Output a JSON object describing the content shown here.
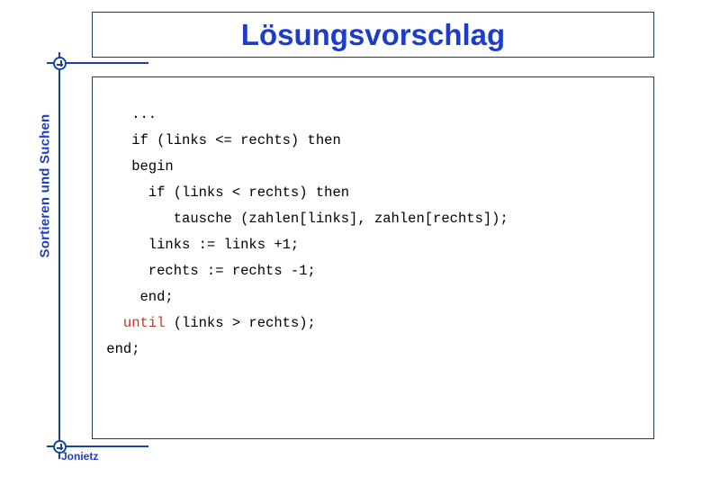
{
  "slide": {
    "title": "Lösungsvorschlag",
    "sidebar_label": "Sortieren und Suchen",
    "footer_author": "Jonietz",
    "colors": {
      "title_blue": "#1c3dc8",
      "rail_blue": "#17459e",
      "frame_border": "#1f3a5f",
      "code_black": "#000000",
      "keyword_red": "#c0392b",
      "background": "#ffffff"
    }
  },
  "code": {
    "language": "pascal",
    "lines": [
      {
        "indent": 4,
        "text": "..."
      },
      {
        "indent": 4,
        "text": "if (links <= rechts) then"
      },
      {
        "indent": 4,
        "text": "begin"
      },
      {
        "indent": 6,
        "text": "if (links < rechts) then"
      },
      {
        "indent": 9,
        "text": "tausche (zahlen[links], zahlen[rechts]);"
      },
      {
        "indent": 6,
        "text": "links := links +1;"
      },
      {
        "indent": 6,
        "text": "rechts := rechts -1;"
      },
      {
        "indent": 5,
        "text": "end;"
      },
      {
        "indent": 3,
        "text": "until (links > rechts);",
        "keyword": "until",
        "keyword_color": "#c0392b"
      },
      {
        "indent": 1,
        "text": "end;"
      }
    ],
    "full_text": "    ...\n    if (links <= rechts) then\n    begin\n      if (links < rechts) then\n         tausche (zahlen[links], zahlen[rechts]);\n      links := links +1;\n      rechts := rechts -1;\n     end;\n   until (links > rechts);\n end;"
  }
}
